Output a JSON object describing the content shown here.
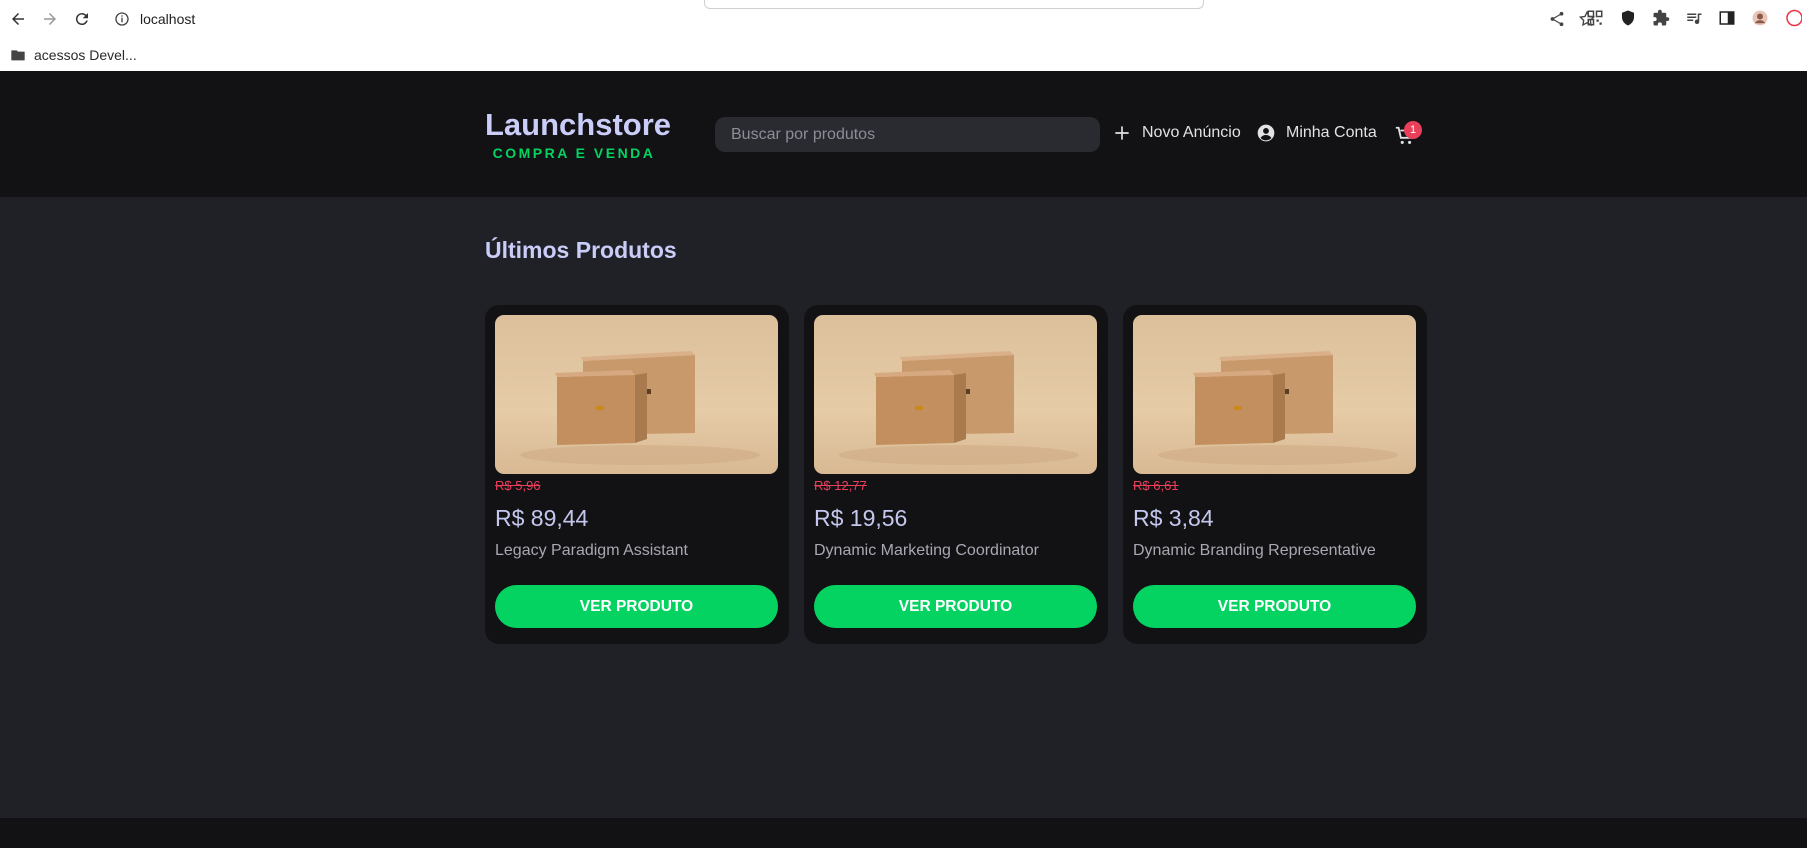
{
  "browser": {
    "url": "localhost",
    "bookmark_label": "acessos Devel..."
  },
  "header": {
    "logo_title": "Launchstore",
    "logo_subtitle": "COMPRA E VENDA",
    "search_placeholder": "Buscar por produtos",
    "new_listing_label": "Novo Anúncio",
    "account_label": "Minha Conta",
    "cart_count": "1"
  },
  "main": {
    "section_title": "Últimos Produtos",
    "products": [
      {
        "old_price": "R$ 5,96",
        "price": "R$ 89,44",
        "name": "Legacy Paradigm Assistant",
        "button_label": "VER PRODUTO"
      },
      {
        "old_price": "R$ 12,77",
        "price": "R$ 19,56",
        "name": "Dynamic Marketing Coordinator",
        "button_label": "VER PRODUTO"
      },
      {
        "old_price": "R$ 6,61",
        "price": "R$ 3,84",
        "name": "Dynamic Branding Representative",
        "button_label": "VER PRODUTO"
      }
    ]
  },
  "colors": {
    "accent_green": "#04d361",
    "old_price_red": "#e83f5b",
    "header_bg": "#121214",
    "page_bg": "#202027",
    "title_lavender": "#c9cdf8"
  },
  "icons": {
    "back": "arrow-left-icon",
    "forward": "arrow-right-icon",
    "reload": "reload-icon",
    "info": "info-icon",
    "share": "share-icon",
    "bookmark_star": "star-icon",
    "new_listing": "plus-icon",
    "account": "account-circle-icon",
    "cart": "cart-icon",
    "folder": "folder-icon"
  }
}
